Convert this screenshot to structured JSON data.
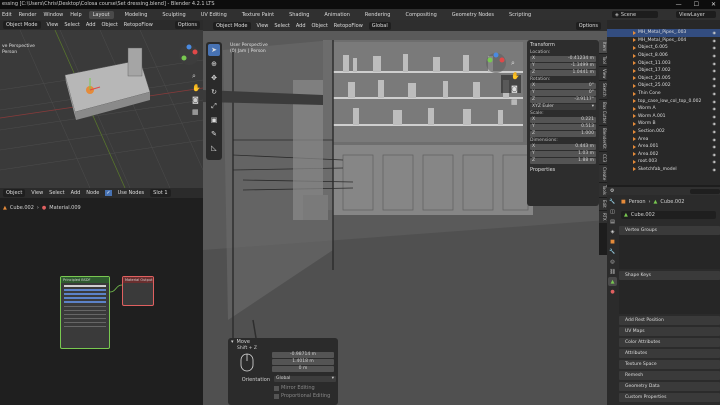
{
  "title_bar": {
    "text": "essing [C:\\Users\\Chris\\Desktop\\Colosa course\\Set dressing.blend] - Blender 4.2.1 LTS"
  },
  "menu": [
    "Edit",
    "Render",
    "Window",
    "Help"
  ],
  "workspaces": [
    "Layout",
    "Modeling",
    "Sculpting",
    "UV Editing",
    "Texture Paint",
    "Shading",
    "Animation",
    "Rendering",
    "Compositing",
    "Geometry Nodes",
    "Scripting"
  ],
  "scene": {
    "label": "Scene",
    "view_layer": "ViewLayer"
  },
  "left_viewport": {
    "header": [
      "Object Mode",
      "View",
      "Select",
      "Add",
      "Object",
      "RetopoFlow",
      "Options"
    ],
    "transform": "Global",
    "info": [
      "ve Perspective",
      "Person"
    ]
  },
  "node_editor": {
    "header": [
      "Object",
      "View",
      "Select",
      "Add",
      "Node",
      "Use Nodes",
      "Slot 1"
    ],
    "breadcrumb": [
      "Cube.002",
      "Material.009"
    ],
    "bsdf_title": "Principled BSDF",
    "output_title": "Material Output"
  },
  "main_viewport": {
    "header": [
      "Object Mode",
      "View",
      "Select",
      "Add",
      "Object",
      "RetopoFlow",
      "Global",
      "Options"
    ],
    "info": [
      "User Perspective",
      "(0) Jam | Person"
    ]
  },
  "n_panel": {
    "title": "Transform",
    "location_label": "Location:",
    "location": [
      {
        "axis": "X",
        "value": "-0.41234 m"
      },
      {
        "axis": "Y",
        "value": "-1.3499 m"
      },
      {
        "axis": "Z",
        "value": "1.0441 m"
      }
    ],
    "rotation_label": "Rotation:",
    "rotation": [
      {
        "axis": "X",
        "value": "0°"
      },
      {
        "axis": "Y",
        "value": "0°"
      },
      {
        "axis": "Z",
        "value": "-3.9117°"
      }
    ],
    "rotation_mode": "XYZ Euler",
    "scale_label": "Scale:",
    "scale": [
      {
        "axis": "X",
        "value": "0.221"
      },
      {
        "axis": "Y",
        "value": "0.513"
      },
      {
        "axis": "Z",
        "value": "1.000"
      }
    ],
    "dimensions_label": "Dimensions:",
    "dimensions": [
      {
        "axis": "X",
        "value": "0.443 m"
      },
      {
        "axis": "Y",
        "value": "1.03 m"
      },
      {
        "axis": "Z",
        "value": "1.88 m"
      }
    ],
    "properties": "Properties"
  },
  "sidebar_tabs": [
    "Item",
    "Tool",
    "View",
    "Sketch",
    "Box Cutter",
    "BlenderKit",
    "CC3",
    "Create",
    "Tools",
    "Edit",
    "RTX",
    "Screenwrite Tools",
    "Hard Ops",
    "photographer"
  ],
  "redo_panel": {
    "title": "Move",
    "shortcut": "Shift + Z",
    "move_values": [
      "-0.98714 m",
      "1.4018 m",
      "0 m"
    ],
    "orientation_label": "Orientation",
    "orientation": "Global",
    "mirror": "Mirror Editing",
    "proportional": "Proportional Editing"
  },
  "outliner": {
    "items": [
      "MH_Metal_Pipes_.003",
      "MH_Metal_Pipes_.004",
      "Object_6.005",
      "Object_8.006",
      "Object_11.003",
      "Object_17.002",
      "Object_21.005",
      "Object_25.002",
      "Thin Cone",
      "top_case_low_col_top_0.002",
      "Worm A",
      "Worm A.001",
      "Worm B",
      "Section.002",
      "Area",
      "Area.001",
      "Area.002",
      "root.003",
      "Sketchfab_model"
    ],
    "selected_index": 0
  },
  "properties": {
    "object": "Person",
    "mesh": "Cube.002",
    "mesh_name": "Cube.002",
    "sections": [
      "Vertex Groups",
      "Shape Keys",
      "Add Rest Position",
      "UV Maps",
      "Color Attributes",
      "Attributes",
      "Texture Space",
      "Remesh",
      "Geometry Data",
      "Custom Properties"
    ]
  },
  "colors": {
    "accent": "#4772b3",
    "orange": "#e58b3a",
    "green": "#78c850"
  }
}
